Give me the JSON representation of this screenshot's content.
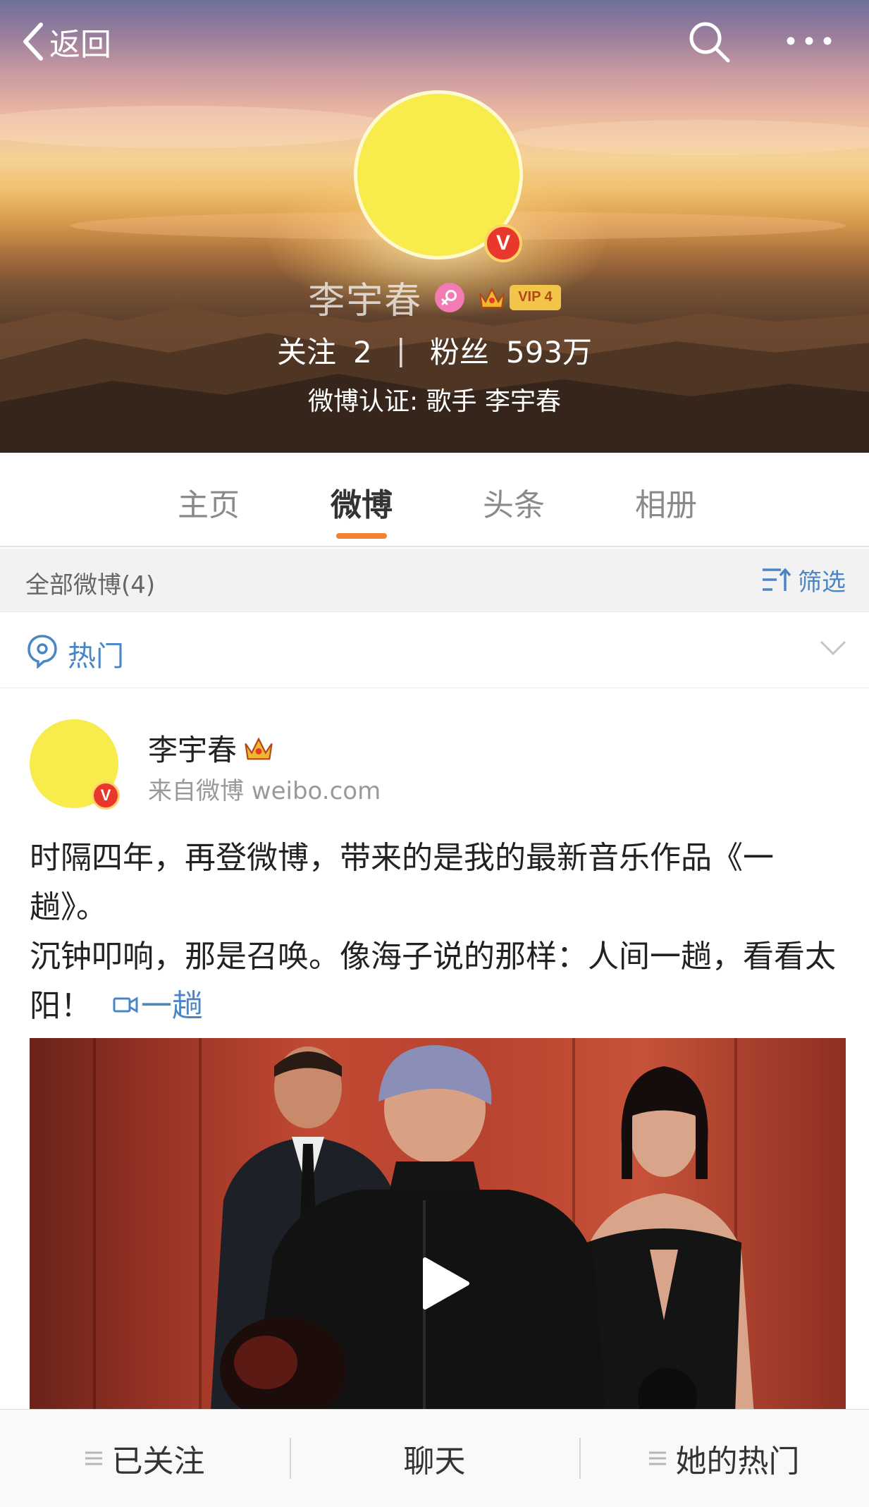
{
  "nav": {
    "back_label": "返回",
    "back_icon": "chevron-left-icon",
    "search_icon": "search-icon",
    "more_icon": "more-horizontal-icon"
  },
  "profile": {
    "name": "李宇春",
    "verified_badge": "V",
    "gender_icon": "female-icon",
    "vip_label": "VIP 4",
    "following_label": "关注",
    "following_count": "2",
    "fans_label": "粉丝",
    "fans_count": "593万",
    "verification": "微博认证: 歌手 李宇春"
  },
  "tabs": [
    {
      "label": "主页",
      "active": false
    },
    {
      "label": "微博",
      "active": true
    },
    {
      "label": "头条",
      "active": false
    },
    {
      "label": "相册",
      "active": false
    }
  ],
  "filter": {
    "count_label": "全部微博(4)",
    "filter_label": "筛选"
  },
  "hot": {
    "label": "热门"
  },
  "post": {
    "author": "李宇春",
    "verified_badge": "V",
    "source": "来自微博 weibo.com",
    "text_line1": "时隔四年，再登微博，带来的是我的最新音乐作品《一趟》。",
    "text_line2": "沉钟叩响，那是召唤。像海子说的那样：人间一趟，看看太阳！",
    "video_link": "一趟"
  },
  "bottom_bar": {
    "followed_label": "已关注",
    "chat_label": "聊天",
    "hot_label": "她的热门"
  },
  "colors": {
    "accent_orange": "#f08232",
    "link_blue": "#4a86c5",
    "avatar_yellow": "#f7ec4b",
    "verified_red": "#e8382b"
  }
}
